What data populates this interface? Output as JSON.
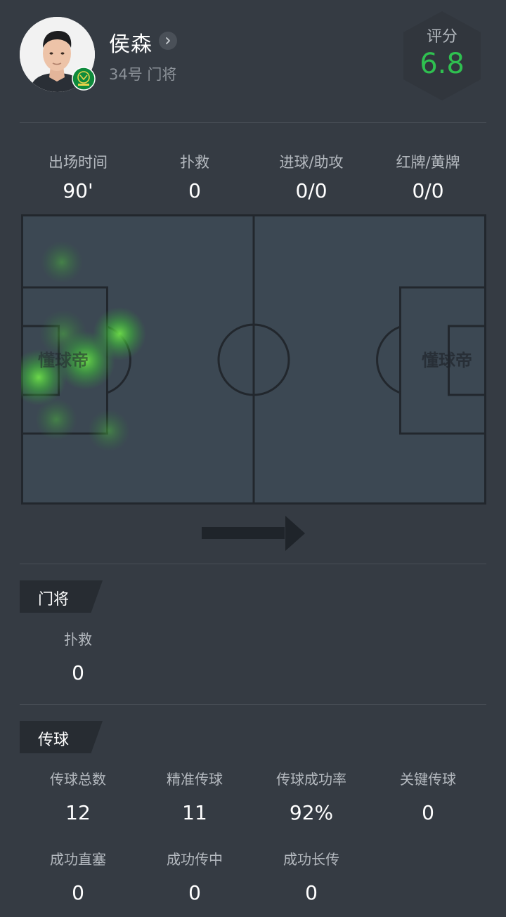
{
  "player": {
    "name": "侯森",
    "number_position": "34号 门将",
    "rating_label": "评分",
    "rating_value": "6.8"
  },
  "summary_stats": [
    {
      "label": "出场时间",
      "value": "90'"
    },
    {
      "label": "扑救",
      "value": "0"
    },
    {
      "label": "进球/助攻",
      "value": "0/0"
    },
    {
      "label": "红牌/黄牌",
      "value": "0/0"
    }
  ],
  "heatmap": {
    "watermark_left": "懂球帝",
    "watermark_right": "懂球帝",
    "attack_direction": "arrow-right-icon"
  },
  "goalkeeper_section": {
    "title": "门将",
    "stats": [
      {
        "label": "扑救",
        "value": "0"
      }
    ]
  },
  "passing_section": {
    "title": "传球",
    "stats": [
      {
        "label": "传球总数",
        "value": "12"
      },
      {
        "label": "精准传球",
        "value": "11"
      },
      {
        "label": "传球成功率",
        "value": "92%"
      },
      {
        "label": "关键传球",
        "value": "0"
      },
      {
        "label": "成功直塞",
        "value": "0"
      },
      {
        "label": "成功传中",
        "value": "0"
      },
      {
        "label": "成功长传",
        "value": "0"
      }
    ]
  },
  "colors": {
    "background": "#353b43",
    "rating": "#2fc050",
    "pitch": "#3c4853",
    "heat": "#4cd43c"
  }
}
